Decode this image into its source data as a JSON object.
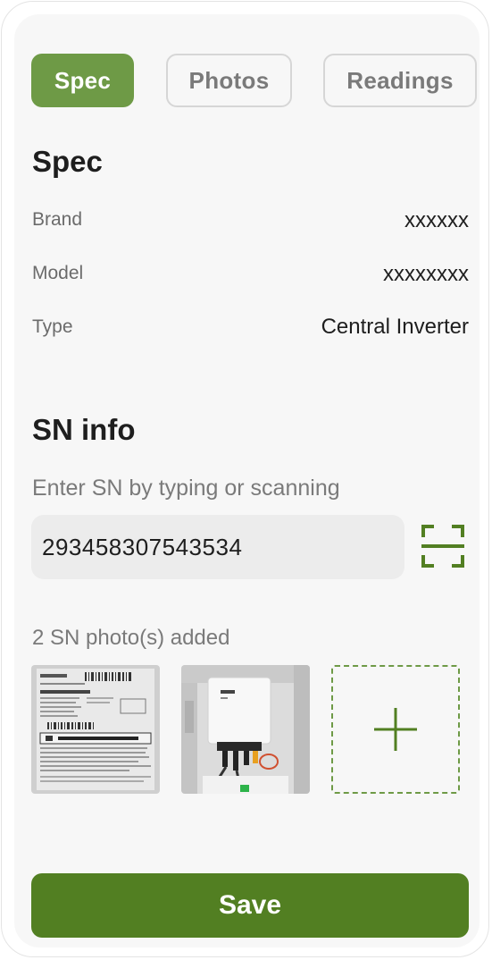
{
  "tabs": [
    {
      "label": "Spec",
      "active": true
    },
    {
      "label": "Photos",
      "active": false
    },
    {
      "label": "Readings",
      "active": false
    }
  ],
  "spec": {
    "title": "Spec",
    "rows": [
      {
        "label": "Brand",
        "value": "xxxxxx"
      },
      {
        "label": "Model",
        "value": "xxxxxxxx"
      },
      {
        "label": "Type",
        "value": "Central Inverter"
      }
    ]
  },
  "sn_info": {
    "title": "SN info",
    "hint": "Enter SN by typing or scanning",
    "sn_value": "293458307543534",
    "photos_added_text": "2 SN photo(s) added",
    "scan_icon": "scan-icon",
    "add_icon": "plus-icon"
  },
  "actions": {
    "save_label": "Save"
  },
  "colors": {
    "accent": "#6e9a46",
    "save": "#527f22",
    "background": "#f7f7f7"
  }
}
